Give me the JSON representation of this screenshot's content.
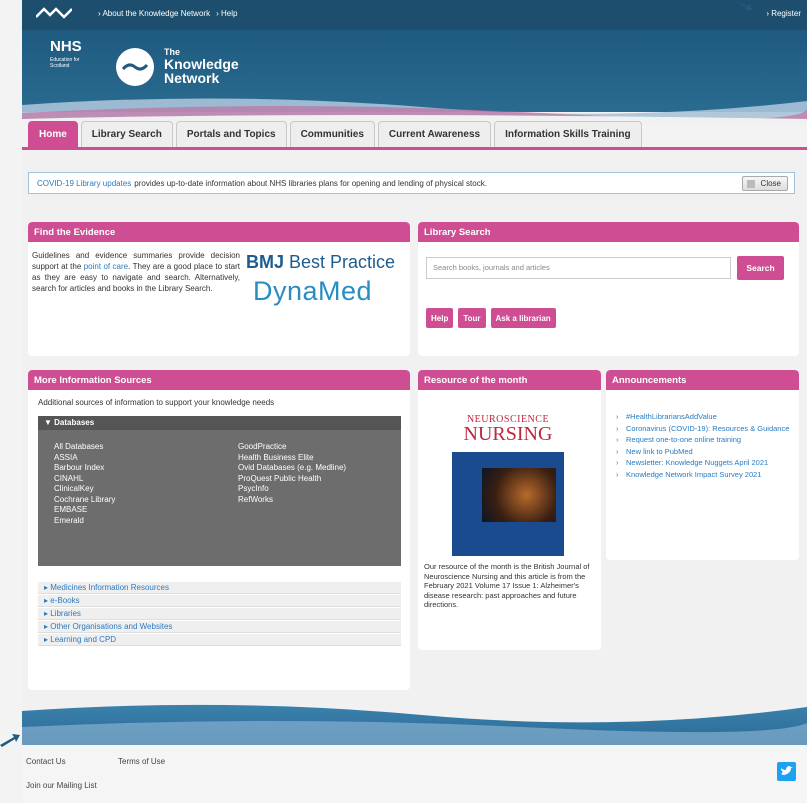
{
  "topbar": {
    "links": [
      "› About the Knowledge Network",
      "› Help"
    ],
    "register": "› Register"
  },
  "header": {
    "nhs": "NHS",
    "nhs_sub": "Education for Scotland",
    "the": "The",
    "title_line1": "Knowledge",
    "title_line2": "Network"
  },
  "tabs": [
    {
      "label": "Home",
      "active": true
    },
    {
      "label": "Library Search"
    },
    {
      "label": "Portals and Topics"
    },
    {
      "label": "Communities"
    },
    {
      "label": "Current Awareness"
    },
    {
      "label": "Information Skills Training"
    }
  ],
  "notice": {
    "link": "COVID-19 Library updates",
    "text": "provides up-to-date information about NHS libraries plans for opening and lending of physical stock.",
    "close": "Close"
  },
  "evidence": {
    "title": "Find the Evidence",
    "text_before": "Guidelines and evidence summaries provide decision support at the",
    "link": "point of care",
    "text_after": ". They are a good place to start as they are easy to navigate and search. Alternatively, search for articles and books in the Library Search.",
    "bmj_strong": "BMJ",
    "bmj_rest": "Best Practice",
    "dynamed": "DynaMed"
  },
  "library_search": {
    "title": "Library Search",
    "placeholder": "Search books, journals and articles",
    "search_button": "Search",
    "buttons": [
      "Help",
      "Tour",
      "Ask a librarian"
    ]
  },
  "more_info": {
    "title": "More Information Sources",
    "intro": "Additional sources of information to support your knowledge needs",
    "databases_label": "Databases",
    "col1": [
      "All Databases",
      "ASSIA",
      "Barbour Index",
      "CINAHL",
      "ClinicalKey",
      "Cochrane Library",
      "EMBASE",
      "Emerald"
    ],
    "col2": [
      "GoodPractice",
      "Health Business Elite",
      "Ovid Databases (e.g. Medline)",
      "ProQuest Public Health",
      "PsycInfo",
      "RefWorks"
    ],
    "accordions": [
      "Medicines Information Resources",
      "e-Books",
      "Libraries",
      "Other Organisations and Websites",
      "Learning and CPD"
    ]
  },
  "resource": {
    "title": "Resource of the month",
    "cover_line1": "NEUROSCIENCE",
    "cover_line2": "NURSING",
    "desc": "Our resource of the month is the British Journal of Neuroscience Nursing and this article is from the February 2021 Volume 17 Issue 1: Alzheimer's disease research: past approaches and future directions."
  },
  "announcements": {
    "title": "Announcements",
    "items": [
      "#HealthLibrariansAddValue",
      "Coronavirus (COVID-19): Resources & Guidance",
      "Request one-to-one online training",
      "New link to PubMed",
      "Newsletter: Knowledge Nuggets April 2021",
      "Knowledge Network Impact Survey 2021"
    ]
  },
  "footer": {
    "contact": "Contact Us",
    "terms": "Terms of Use",
    "mailing": "Join our Mailing List"
  },
  "colors": {
    "accent": "#cf4d93",
    "header": "#1f5a80",
    "link": "#2b7bc0"
  }
}
